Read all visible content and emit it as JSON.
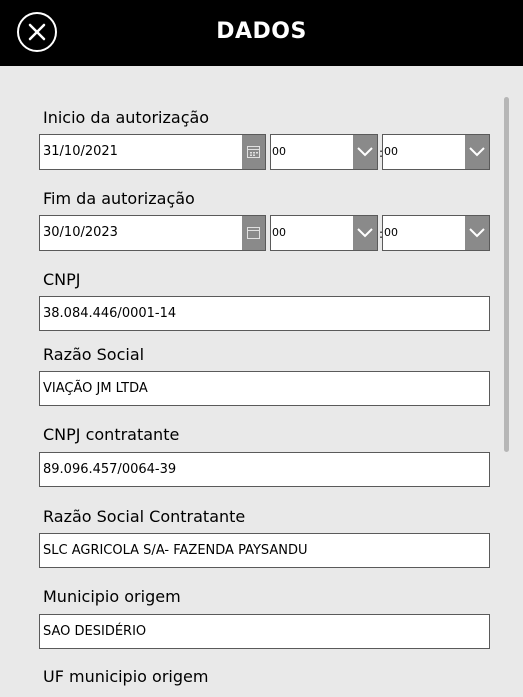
{
  "header": {
    "title": "DADOS",
    "close_icon": "close-circle-icon"
  },
  "form": {
    "inicio": {
      "label": "Inicio da autorização",
      "date": "31/10/2021",
      "hour": "00",
      "minute": "00",
      "separator": ":"
    },
    "fim": {
      "label": "Fim da autorização",
      "date": "30/10/2023",
      "hour": "00",
      "minute": "00",
      "separator": ":"
    },
    "cnpj": {
      "label": "CNPJ",
      "value": "38.084.446/0001-14"
    },
    "razao_social": {
      "label": "Razão Social",
      "value": "VIAÇÃO JM LTDA"
    },
    "cnpj_contratante": {
      "label": "CNPJ contratante",
      "value": "89.096.457/0064-39"
    },
    "razao_social_contratante": {
      "label": "Razão Social Contratante",
      "value": "SLC AGRICOLA S/A- FAZENDA PAYSANDU"
    },
    "municipio_origem": {
      "label": "Municipio origem",
      "value": "SAO DESIDÉRIO"
    },
    "uf_municipio_origem": {
      "label": "UF municipio origem"
    }
  },
  "icons": {
    "calendar": "calendar-icon",
    "dropdown": "chevron-down-icon"
  },
  "colors": {
    "header_bg": "#000000",
    "page_bg": "#e9e9e9",
    "button_bg": "#8a8a8a"
  }
}
